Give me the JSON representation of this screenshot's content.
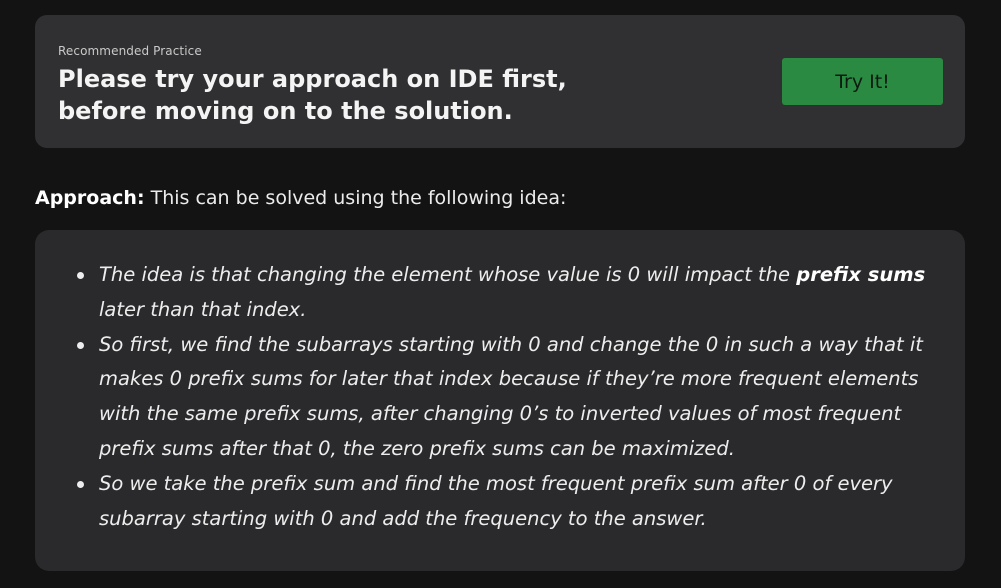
{
  "practice": {
    "eyebrow": "Recommended Practice",
    "heading": "Please try your approach on IDE first, before moving on to the solution.",
    "button_label": "Try It!"
  },
  "approach": {
    "label": "Approach:",
    "text": "This can be solved using the following idea:"
  },
  "ideas": [
    {
      "before": "The idea is that changing the element whose value is 0 will impact the ",
      "bold": "prefix sums",
      "after": " later than that index."
    },
    {
      "text": "So first, we find the subarrays starting with 0 and change the 0 in such a way that it makes 0 prefix sums for later that index because if they’re more frequent elements with the same prefix sums, after changing 0’s to inverted values of most frequent prefix sums after that 0, the zero prefix sums can be maximized."
    },
    {
      "text": "So we take the prefix sum and find the most frequent prefix sum after 0 of every subarray starting with 0 and add the frequency to the answer."
    }
  ],
  "colors": {
    "page_background": "#131313",
    "card_background": "#303032",
    "button_background": "#2b8a42"
  }
}
